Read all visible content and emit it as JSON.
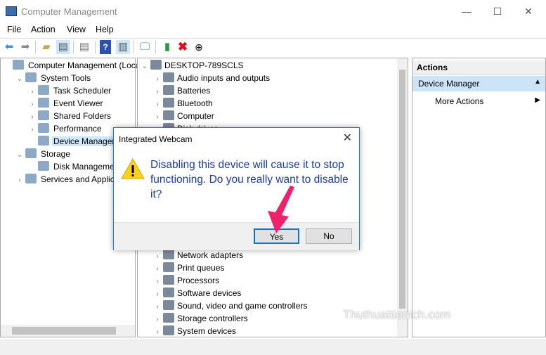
{
  "window": {
    "title": "Computer Management",
    "controls": [
      "—",
      "☐",
      "✕"
    ]
  },
  "menu": [
    "File",
    "Action",
    "View",
    "Help"
  ],
  "toolbar": [
    "back-icon",
    "forward-icon",
    "up-folder-icon",
    "show-hide-tree-icon",
    "properties-icon",
    "help-icon",
    "action-pane-icon",
    "scan-hardware-icon",
    "update-driver-icon",
    "uninstall-icon",
    "disable-icon"
  ],
  "left_tree": [
    {
      "label": "Computer Management (Local",
      "level": 0,
      "arrow": ""
    },
    {
      "label": "System Tools",
      "level": 1,
      "arrow": "⌄"
    },
    {
      "label": "Task Scheduler",
      "level": 2,
      "arrow": "›"
    },
    {
      "label": "Event Viewer",
      "level": 2,
      "arrow": "›"
    },
    {
      "label": "Shared Folders",
      "level": 2,
      "arrow": "›"
    },
    {
      "label": "Performance",
      "level": 2,
      "arrow": "›"
    },
    {
      "label": "Device Manager",
      "level": 2,
      "arrow": "",
      "selected": true
    },
    {
      "label": "Storage",
      "level": 1,
      "arrow": "⌄"
    },
    {
      "label": "Disk Management",
      "level": 2,
      "arrow": ""
    },
    {
      "label": "Services and Applicatio",
      "level": 1,
      "arrow": "›"
    }
  ],
  "device_tree": {
    "root": "DESKTOP-789SCLS",
    "items_top": [
      "Audio inputs and outputs",
      "Batteries",
      "Bluetooth",
      "Computer",
      "Disk drives"
    ],
    "items_bottom": [
      "Network adapters",
      "Print queues",
      "Processors",
      "Software devices",
      "Sound, video and game controllers",
      "Storage controllers",
      "System devices"
    ]
  },
  "actions": {
    "header": "Actions",
    "section": "Device Manager",
    "more": "More Actions"
  },
  "dialog": {
    "title": "Integrated Webcam",
    "message": "Disabling this device will cause it to stop functioning. Do you really want to disable it?",
    "yes": "Yes",
    "no": "No"
  },
  "watermark": "Thuthuattienich.com",
  "colors": {
    "accent": "#1979ca",
    "message": "#1a3d9c",
    "arrow": "#f0206a",
    "selection": "#cce8ff"
  }
}
